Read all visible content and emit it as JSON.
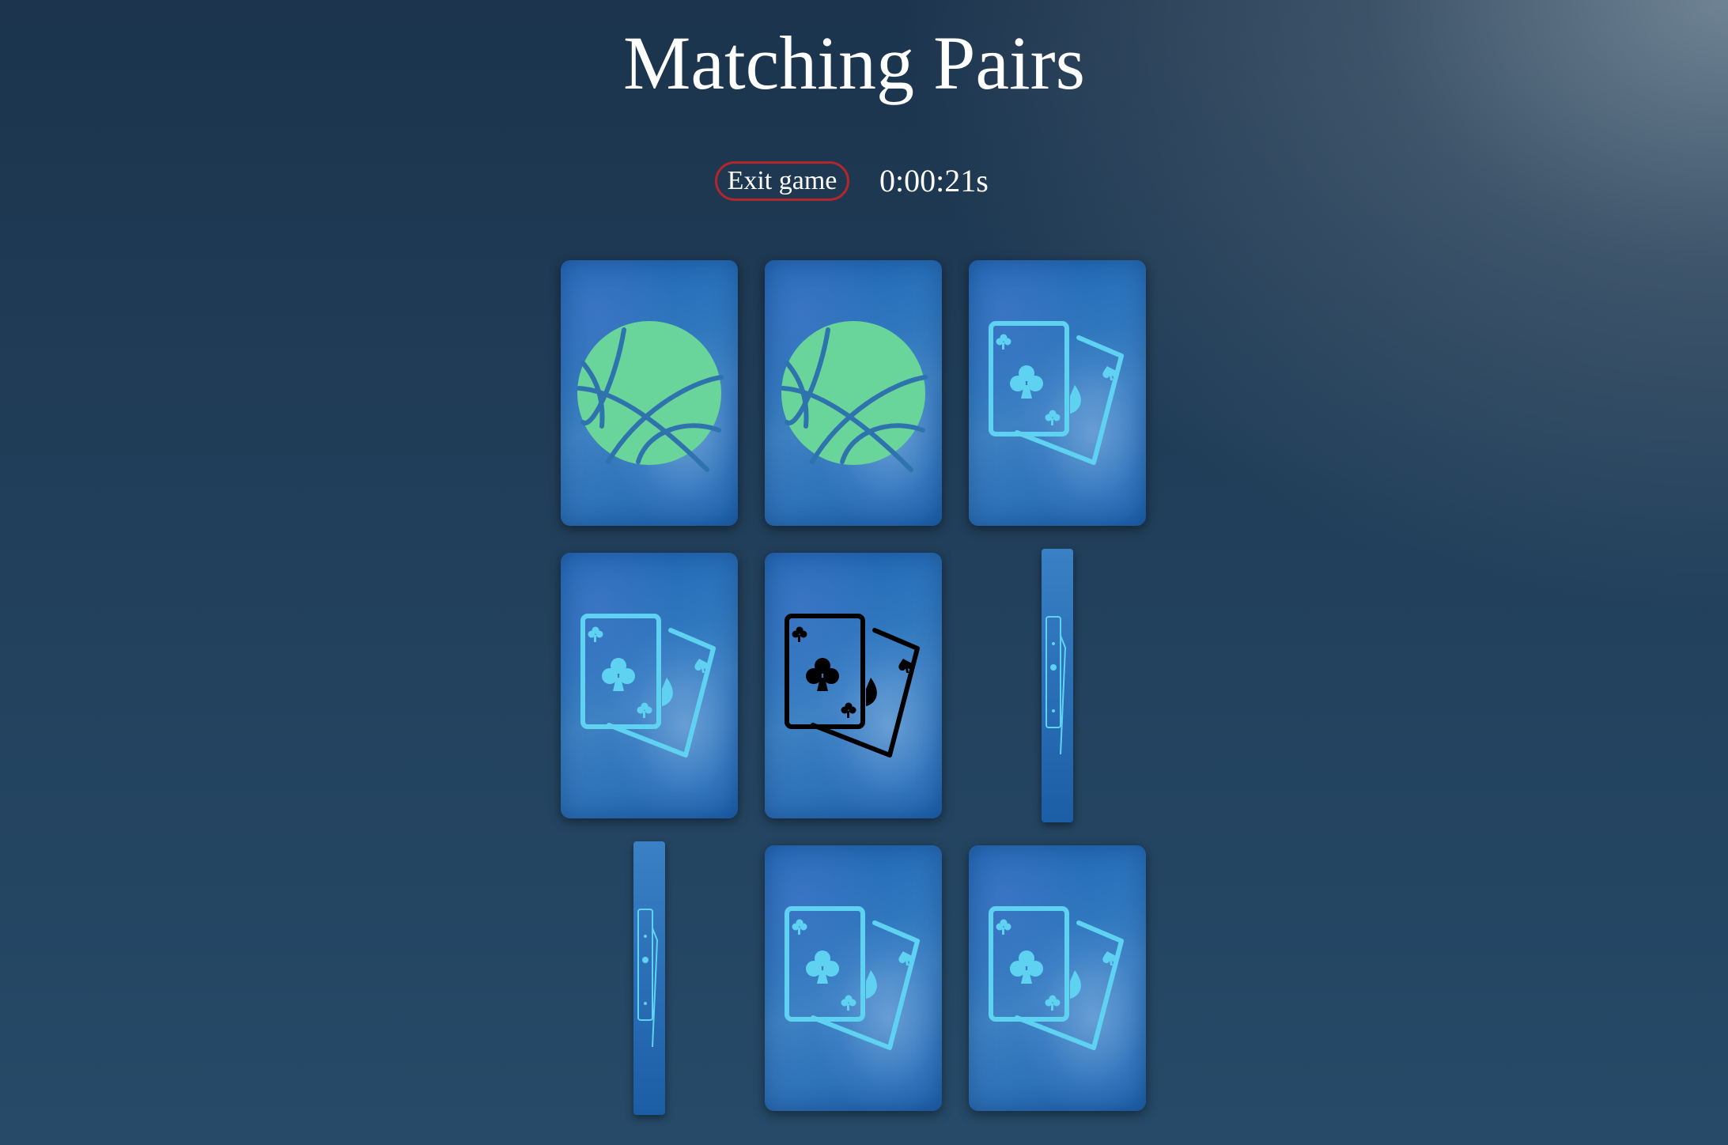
{
  "header": {
    "title": "Matching Pairs"
  },
  "controls": {
    "exit_label": "Exit game",
    "timer": "0:00:21s"
  },
  "colors": {
    "exit_border": "#b3262c",
    "basketball": "#6ad59a",
    "basketball_lines": "#2e73ae",
    "cards_icon_active": "#5fd2f2",
    "cards_icon_selected": "#000000"
  },
  "cards": [
    {
      "icon": "basketball-icon",
      "state": "face-up"
    },
    {
      "icon": "basketball-icon",
      "state": "face-up"
    },
    {
      "icon": "playing-cards-icon",
      "state": "face-up"
    },
    {
      "icon": "playing-cards-icon",
      "state": "face-up"
    },
    {
      "icon": "playing-cards-icon",
      "state": "selected"
    },
    {
      "icon": "playing-cards-icon",
      "state": "flipping"
    },
    {
      "icon": "playing-cards-icon",
      "state": "flipping"
    },
    {
      "icon": "playing-cards-icon",
      "state": "face-up"
    },
    {
      "icon": "playing-cards-icon",
      "state": "face-up"
    }
  ]
}
